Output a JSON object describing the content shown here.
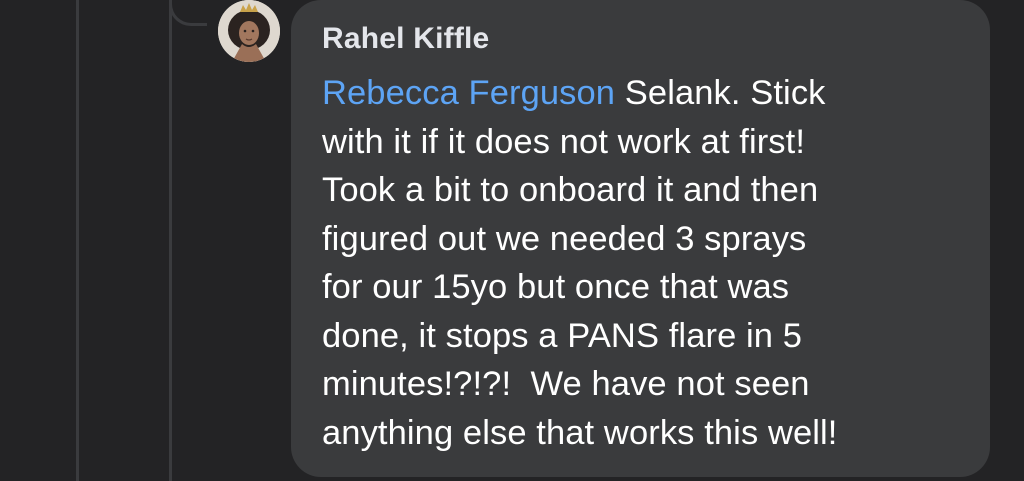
{
  "comment": {
    "author": "Rahel Kiffle",
    "mention": "Rebecca Ferguson",
    "text": " Selank. Stick\nwith it if it does not work at first!\nTook a bit to onboard it and then\nfigured out we needed 3 sprays\nfor our 15yo but once that was\ndone, it stops a PANS flare in 5\nminutes!?!?!  We have not seen\nanything else that works this well!"
  },
  "colors": {
    "background": "#232325",
    "bubble": "#3a3b3d",
    "mention": "#5da4f5",
    "text": "#ffffff"
  }
}
